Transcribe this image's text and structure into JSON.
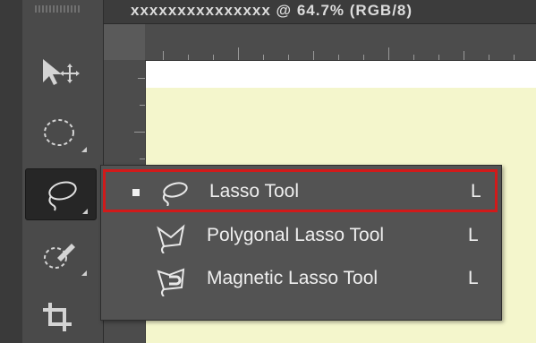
{
  "document": {
    "tab_title": "xxxxxxxxxxxxxxx @ 64.7% (RGB/8)"
  },
  "toolbar": {
    "tools": [
      {
        "name": "move-tool",
        "icon": "move-icon"
      },
      {
        "name": "marquee-tool",
        "icon": "elliptical-marquee-icon"
      },
      {
        "name": "lasso-tool",
        "icon": "lasso-icon",
        "active": true
      },
      {
        "name": "quick-selection-tool",
        "icon": "quick-selection-icon"
      },
      {
        "name": "crop-tool",
        "icon": "crop-icon"
      }
    ]
  },
  "flyout": {
    "items": [
      {
        "label": "Lasso Tool",
        "shortcut": "L",
        "selected": true,
        "icon": "lasso-icon"
      },
      {
        "label": "Polygonal Lasso Tool",
        "shortcut": "L",
        "selected": false,
        "icon": "polygonal-lasso-icon"
      },
      {
        "label": "Magnetic Lasso Tool",
        "shortcut": "L",
        "selected": false,
        "icon": "magnetic-lasso-icon"
      }
    ]
  },
  "colors": {
    "highlight": "#d11a1a",
    "menu_bg": "#535353",
    "canvas": "#f4f6cc"
  }
}
